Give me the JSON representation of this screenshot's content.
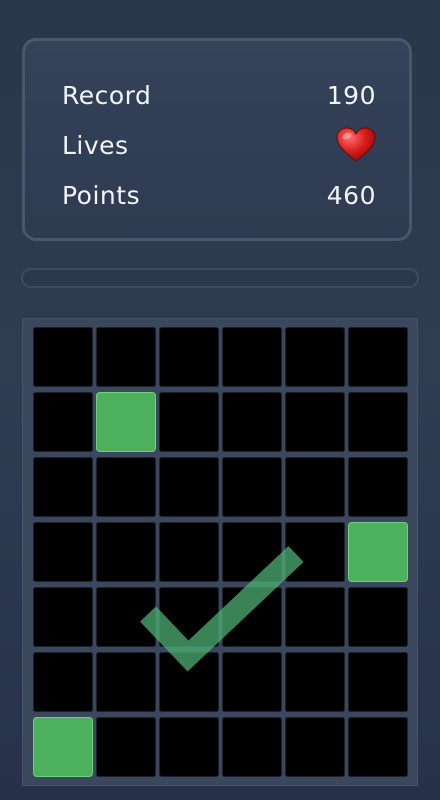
{
  "stats": {
    "record": {
      "label": "Record",
      "value": "190"
    },
    "lives": {
      "label": "Lives",
      "count": 1,
      "icon": "heart-icon"
    },
    "points": {
      "label": "Points",
      "value": "460"
    }
  },
  "progress": {
    "fraction": 0.0
  },
  "board": {
    "rows": 7,
    "cols": 6,
    "lit_cells": [
      [
        1,
        1
      ],
      [
        3,
        5
      ],
      [
        6,
        0
      ]
    ]
  },
  "feedback": {
    "icon": "checkmark-icon",
    "state": "correct"
  },
  "colors": {
    "tile_lit": "#4cb05c",
    "tile_dark": "#000000",
    "heart": "#d81c1c",
    "check": "#4caf73"
  }
}
